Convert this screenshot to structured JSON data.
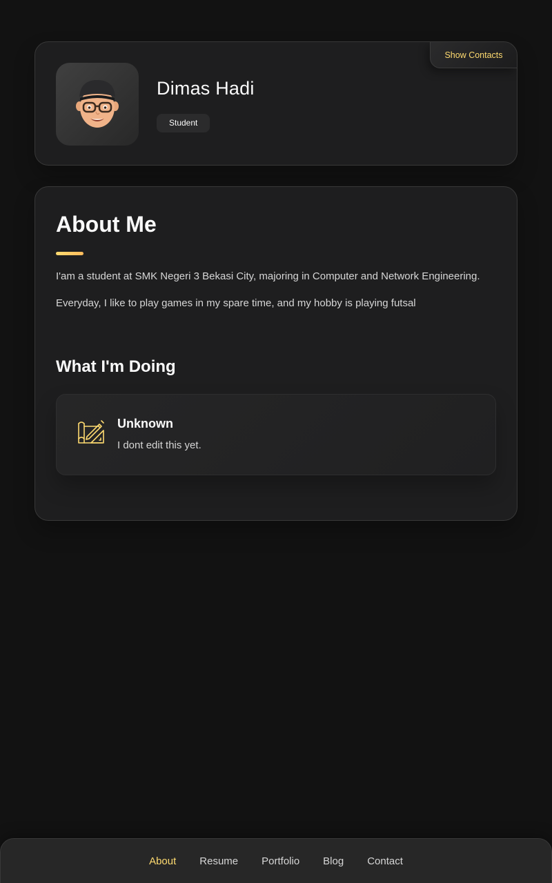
{
  "profile": {
    "name": "Dimas Hadi",
    "title": "Student",
    "show_contacts_label": "Show Contacts"
  },
  "about": {
    "heading": "About Me",
    "paragraphs": [
      "I'am a student at SMK Negeri 3 Bekasi City, majoring in Computer and Network Engineering.",
      "Everyday, I like to play games in my spare time, and my hobby is playing futsal"
    ]
  },
  "services": {
    "heading": "What I'm Doing",
    "items": [
      {
        "icon": "design-icon",
        "title": "Unknown",
        "text": "I dont edit this yet."
      }
    ]
  },
  "navbar": {
    "items": [
      {
        "label": "About",
        "active": true
      },
      {
        "label": "Resume",
        "active": false
      },
      {
        "label": "Portfolio",
        "active": false
      },
      {
        "label": "Blog",
        "active": false
      },
      {
        "label": "Contact",
        "active": false
      }
    ]
  },
  "colors": {
    "accent": "#ffdb70",
    "background": "#121212",
    "card": "#1e1e1f"
  }
}
